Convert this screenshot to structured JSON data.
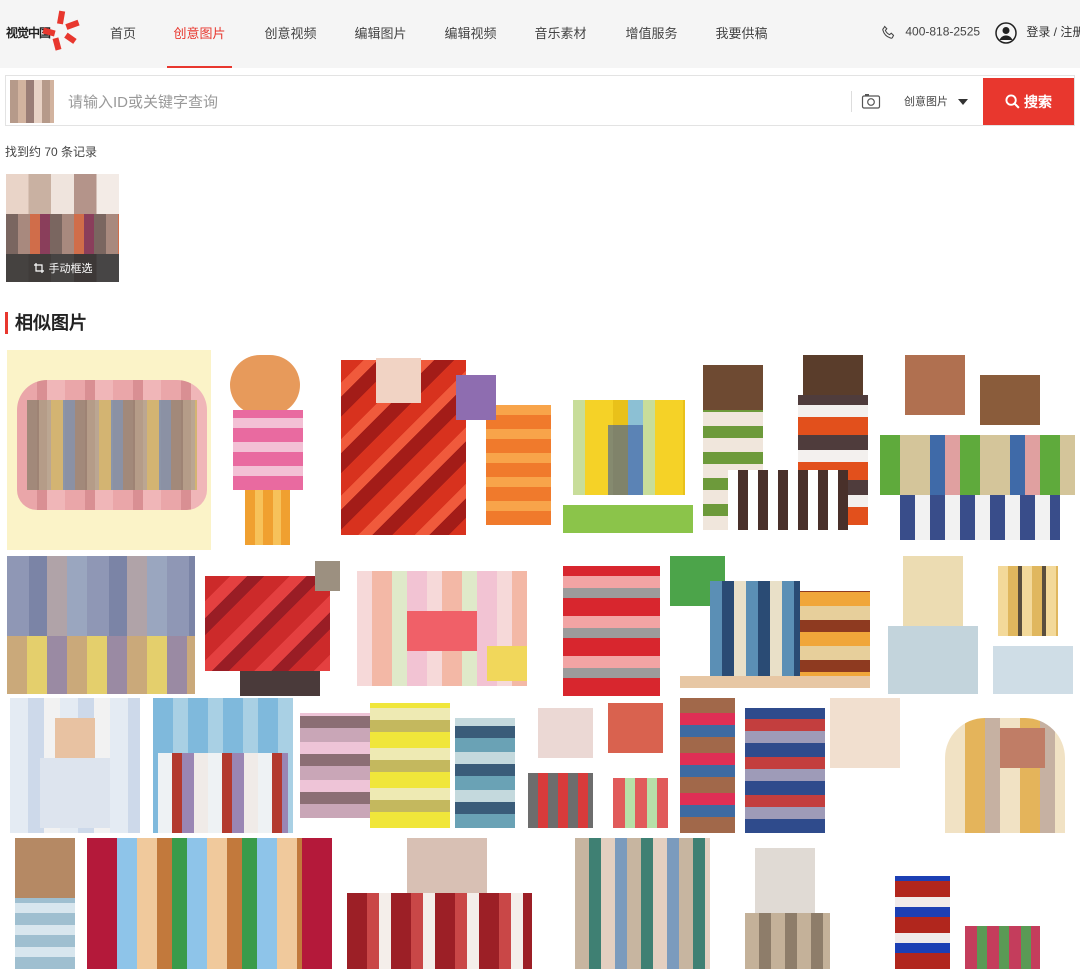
{
  "header": {
    "logo_text": "视觉中国",
    "nav": [
      {
        "label": "首页",
        "active": false
      },
      {
        "label": "创意图片",
        "active": true
      },
      {
        "label": "创意视频",
        "active": false
      },
      {
        "label": "编辑图片",
        "active": false
      },
      {
        "label": "编辑视频",
        "active": false
      },
      {
        "label": "音乐素材",
        "active": false
      },
      {
        "label": "增值服务",
        "active": false
      },
      {
        "label": "我要供稿",
        "active": false
      }
    ],
    "phone": "400-818-2525",
    "login": "登录 / 注册"
  },
  "search": {
    "placeholder": "请输入ID或关键字查询",
    "value": "",
    "type_label": "创意图片",
    "button_label": "搜索"
  },
  "results": {
    "count_text": "找到约 70 条记录",
    "manual_select_label": "手动框选",
    "section_title": "相似图片"
  },
  "colors": {
    "accent": "#e8372e",
    "header_bg": "#f5f5f5"
  },
  "icons": {
    "phone": "phone-icon",
    "user": "user-icon",
    "camera": "camera-icon",
    "search": "search-icon",
    "crop": "crop-icon"
  }
}
